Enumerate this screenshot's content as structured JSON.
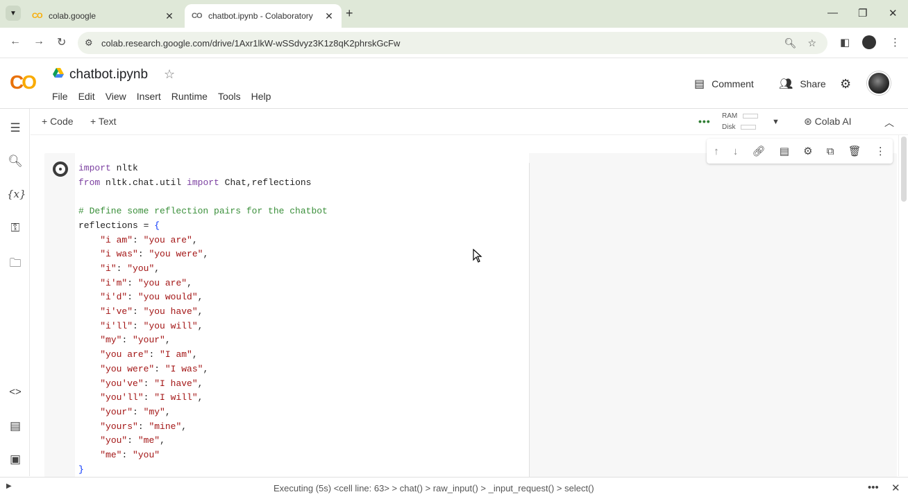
{
  "browser": {
    "tabs": [
      {
        "favicon": "colab-icon",
        "title": "colab.google",
        "active": false
      },
      {
        "favicon": "colab-icon",
        "title": "chatbot.ipynb - Colaboratory",
        "active": true
      }
    ],
    "url": "colab.research.google.com/drive/1Axr1lkW-wSSdvyz3K1z8qK2phrskGcFw"
  },
  "colab": {
    "logo": "CO",
    "notebook_title": "chatbot.ipynb",
    "menu": [
      "File",
      "Edit",
      "View",
      "Insert",
      "Runtime",
      "Tools",
      "Help"
    ],
    "comment_label": "Comment",
    "share_label": "Share",
    "add_code_label": "+ Code",
    "add_text_label": "+ Text",
    "ram_label": "RAM",
    "disk_label": "Disk",
    "colab_ai_label": "Colab AI"
  },
  "cell": {
    "code_lines": [
      "import nltk",
      "from nltk.chat.util import Chat,reflections",
      "",
      "# Define some reflection pairs for the chatbot",
      "reflections = {",
      "    \"i am\": \"you are\",",
      "    \"i was\": \"you were\",",
      "    \"i\": \"you\",",
      "    \"i'm\": \"you are\",",
      "    \"i'd\": \"you would\",",
      "    \"i've\": \"you have\",",
      "    \"i'll\": \"you will\",",
      "    \"my\": \"your\",",
      "    \"you are\": \"I am\",",
      "    \"you were\": \"I was\",",
      "    \"you've\": \"I have\",",
      "    \"you'll\": \"I will\",",
      "    \"your\": \"my\",",
      "    \"yours\": \"mine\",",
      "    \"you\": \"me\",",
      "    \"me\": \"you\"",
      "}"
    ]
  },
  "status": {
    "text": "Executing (5s)  <cell line: 63> > chat() > raw_input() > _input_request() > select()"
  }
}
